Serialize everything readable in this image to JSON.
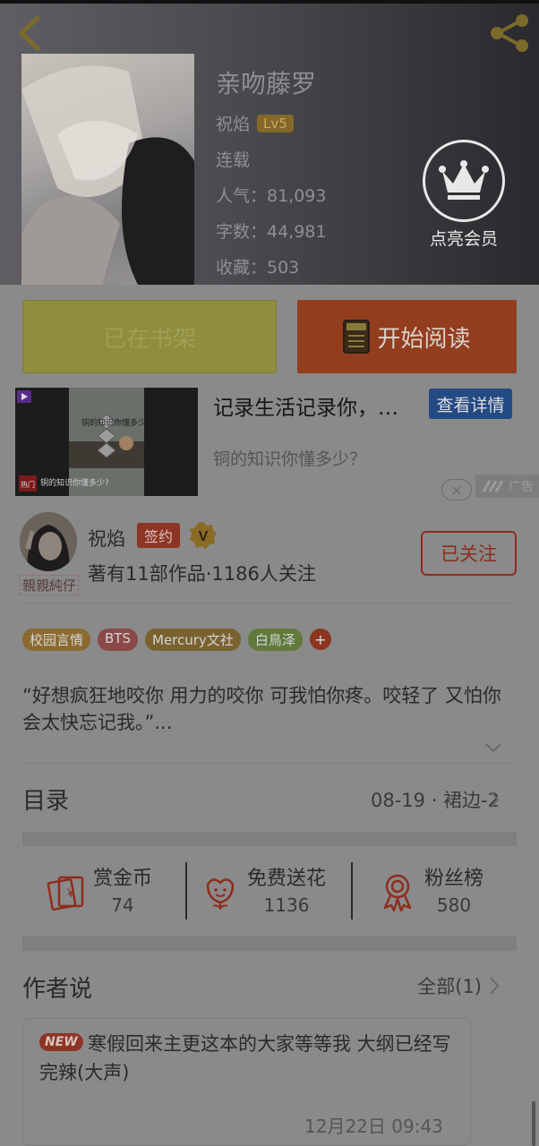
{
  "book": {
    "title": "亲吻藤罗",
    "author": "祝焰",
    "level": "Lv5",
    "status": "连载",
    "popularity": "人气：81,093",
    "word_count": "字数：44,981",
    "favorites": "收藏：503"
  },
  "vip": {
    "label": "点亮会员"
  },
  "actions": {
    "shelf_label": "已在书架",
    "read_label": "开始阅读"
  },
  "ad": {
    "title": "记录生活记录你，…",
    "button_label": "查看详情",
    "subtitle": "铜的知识你懂多少？",
    "close_symbol": "×",
    "tag": "广告",
    "image_caption": "铜的知识你懂多少?",
    "image_overlay_text": "铜的知识你懂多少",
    "image_hot_tag": "热门"
  },
  "author_card": {
    "avatar_caption": "親親純仔",
    "name": "祝焰",
    "sign_badge": "签约",
    "stats": "著有11部作品·1186人关注",
    "follow_label": "已关注"
  },
  "tags": [
    {
      "label": "校园言情",
      "color": "#8a6a30"
    },
    {
      "label": "BTS",
      "color": "#8a4a48"
    },
    {
      "label": "Mercury文社",
      "color": "#7a6230"
    },
    {
      "label": "白鳥泽",
      "color": "#5f7a3a"
    }
  ],
  "tag_more": "+",
  "description": "“好想疯狂地咬你 用力的咬你 可我怕你疼。咬轻了 又怕你会太快忘记我。”...",
  "toc": {
    "title": "目录",
    "latest": "08-19 · 裙边-2"
  },
  "stats": [
    {
      "label": "赏金币",
      "value": "74"
    },
    {
      "label": "免费送花",
      "value": "1136"
    },
    {
      "label": "粉丝榜",
      "value": "580"
    }
  ],
  "author_says": {
    "title": "作者说",
    "all_label": "全部(1)",
    "new_badge": "NEW",
    "text": "寒假回来主更这本的大家等等我 大纲已经写完辣(大声)",
    "time": "12月22日  09:43"
  },
  "colors": {
    "accent_red": "#8e3424",
    "read_button": "#933d1f",
    "shelf_button": "#8e8e3e"
  }
}
